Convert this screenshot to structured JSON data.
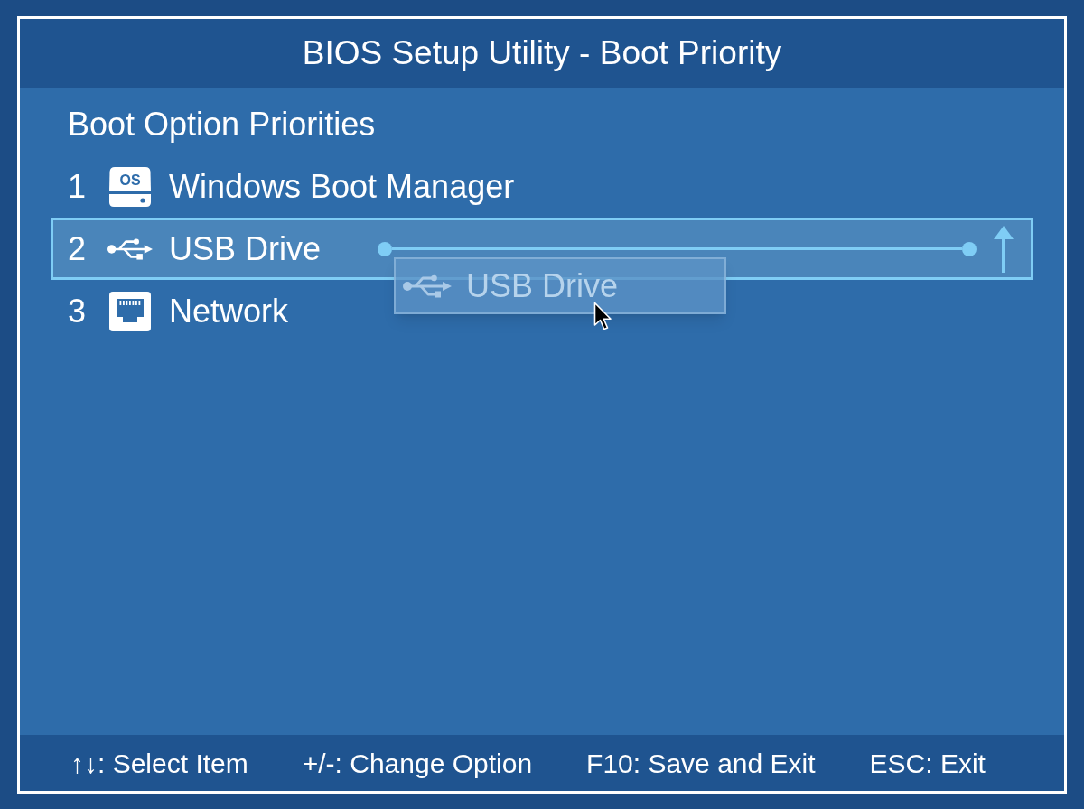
{
  "window": {
    "title": "BIOS Setup Utility - Boot Priority"
  },
  "section_heading": "Boot Option Priorities",
  "boot_options": [
    {
      "number": "1",
      "kind": "disk",
      "icon_text": "OS",
      "label": "Windows Boot Manager",
      "selected": false,
      "drop_target": false
    },
    {
      "number": "2",
      "kind": "usb",
      "label": "USB Drive",
      "selected": true,
      "drop_target": true
    },
    {
      "number": "3",
      "kind": "network",
      "label": "Network",
      "selected": false,
      "drop_target": false
    }
  ],
  "drag_preview": {
    "kind": "usb",
    "label": "USB Drive"
  },
  "footer": {
    "hints": [
      "↑↓: Select Item",
      "+/-: Change Option",
      "F10: Save and Exit",
      "ESC: Exit"
    ]
  }
}
